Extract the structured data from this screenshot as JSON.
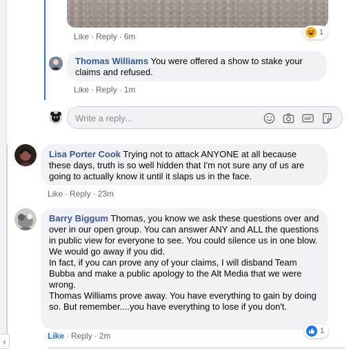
{
  "top_comment": {
    "actions": {
      "like": "Like",
      "reply": "Reply",
      "time": "6m"
    },
    "reaction": {
      "icon": "haha-emoji-icon",
      "count": "1"
    }
  },
  "reply_comment": {
    "author": "Thomas Williams",
    "text": "You were offered a show to stake your claims and refused.",
    "actions": {
      "like": "Like",
      "reply": "Reply",
      "time": "1m"
    }
  },
  "composer": {
    "placeholder": "Write a reply...",
    "icons": [
      "emoji-icon",
      "camera-icon",
      "gif-icon",
      "sticker-icon"
    ]
  },
  "comments": [
    {
      "author": "Lisa Porter Cook",
      "text": "Trying not to attack ANYONE at all because these days, truth is so well hidden that I'm not sure any of us are going to actually know it until it slaps us in the face.",
      "actions": {
        "like": "Like",
        "reply": "Reply",
        "time": "23m"
      }
    },
    {
      "author": "Barry Biggum",
      "paragraphs": [
        "Thomas, you know we ask these questions over and over in our open group. You can answer ANY and ALL the questions in public view for everyone to see. You could silence us in one blow. We would go away if you did.",
        "In fact, if you can prove any of your claims, I will disband Team Bubba and make a public apology to the Alt Media that we were wrong.",
        "Thomas Williams prove away. You have everything to gain by doing so. But remember....you have everything to lose if you don't."
      ],
      "actions": {
        "like": "Like",
        "reply": "Reply",
        "time": "2m"
      },
      "reaction": {
        "icon": "like-thumb-icon",
        "count": "1"
      }
    }
  ],
  "colors": {
    "accent": "#1877f2",
    "author_link": "#385898",
    "bubble_bg": "#f0f2f5",
    "meta_text": "#65676b"
  }
}
